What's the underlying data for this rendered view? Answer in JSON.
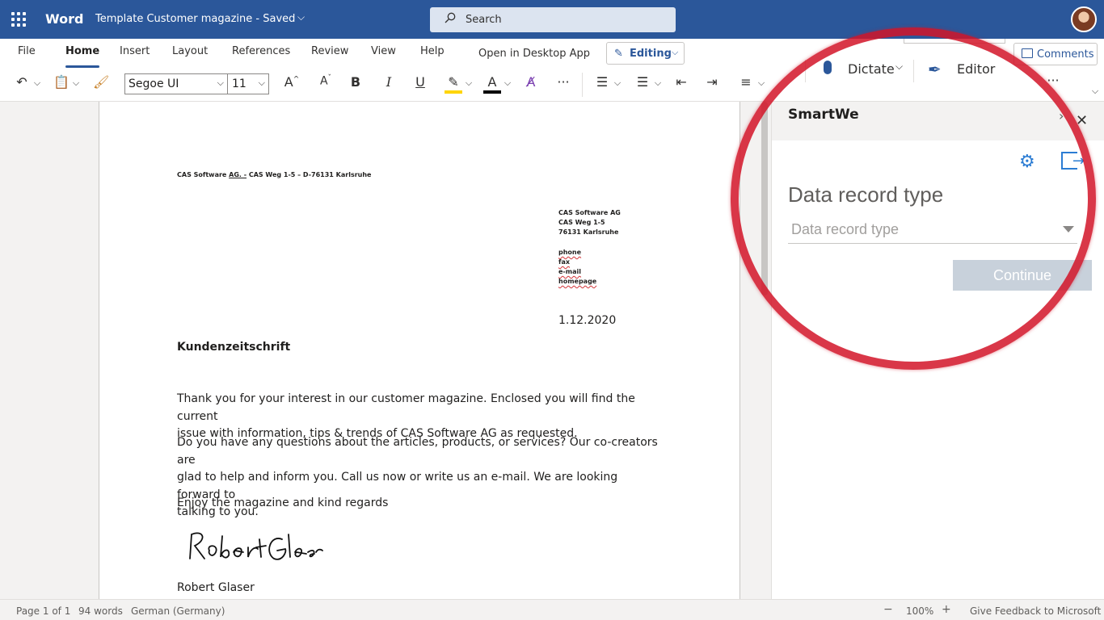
{
  "titlebar": {
    "app_name": "Word",
    "doc_title": "Template Customer magazine",
    "status": "Saved",
    "search_placeholder": "Search"
  },
  "ribbon": {
    "tabs": [
      "File",
      "Home",
      "Insert",
      "Layout",
      "References",
      "Review",
      "View",
      "Help"
    ],
    "active_tab": "Home",
    "open_desktop": "Open in Desktop App",
    "editing_label": "Editing",
    "comments_label": "Comments",
    "font_name": "Segoe UI",
    "font_size": "11",
    "dictate_label": "Dictate",
    "editor_label": "Editor"
  },
  "document": {
    "sender_line_a": "CAS Software ",
    "sender_line_ag": "AG. -",
    "sender_line_b": " CAS Weg 1-5 – D-76131 Karlsruhe",
    "address": [
      "CAS Software AG",
      "CAS Weg 1-5",
      "76131 Karlsruhe"
    ],
    "contact": [
      "phone",
      "fax",
      "e-mail",
      "homepage"
    ],
    "date": "1.12.2020",
    "heading": "Kundenzeitschrift",
    "p1_line1": "Thank you for your interest in our customer magazine. Enclosed you will find the current",
    "p1_line2": "issue with information, tips & trends of CAS Software AG as requested.",
    "p2_line1": "Do you have any questions about the articles, products, or services? Our co-creators are",
    "p2_line2": "glad to help and inform you. Call us now or write us an e-mail. We are looking forward to",
    "p2_line3": "talking to you.",
    "p3": "Enjoy the magazine and kind regards",
    "signature_name": "Robert Glaser"
  },
  "pane": {
    "title": "SmartWe",
    "field_label": "Data record type",
    "select_placeholder": "Data record type",
    "continue_label": "Continue"
  },
  "statusbar": {
    "page": "Page 1 of 1",
    "words": "94 words",
    "language": "German (Germany)",
    "zoom": "100%",
    "feedback": "Give Feedback to Microsoft"
  },
  "colors": {
    "brand": "#2b579a",
    "highlight_circle": "#d21428",
    "button_disabled": "#c8d1db"
  }
}
